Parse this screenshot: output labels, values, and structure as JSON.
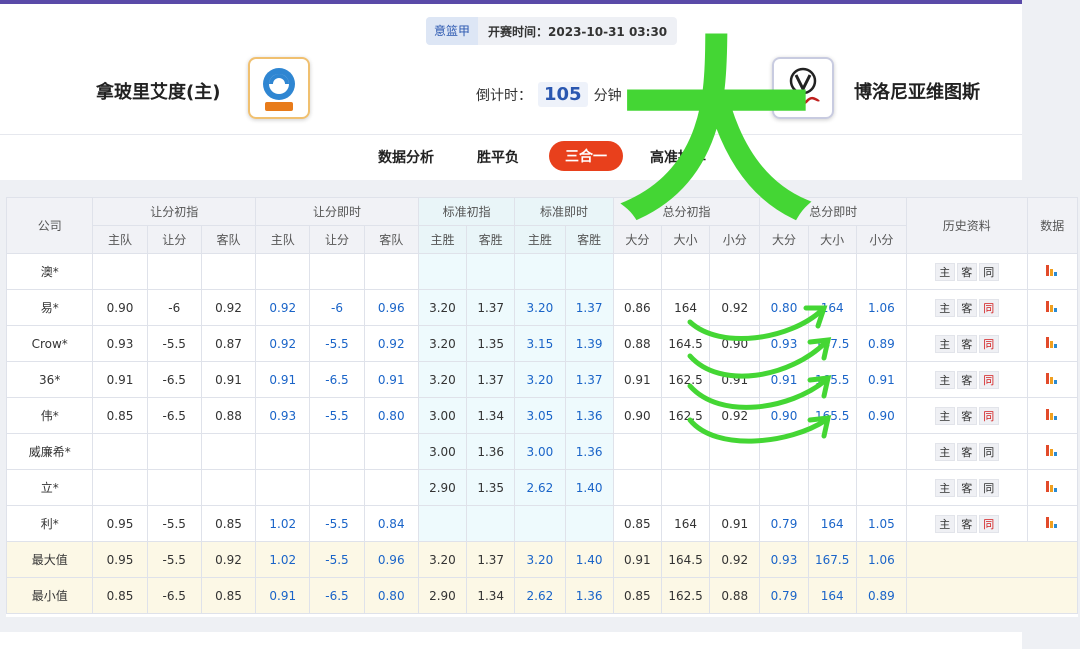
{
  "header": {
    "league": "意篮甲",
    "kickoff": "开赛时间：2023-10-31 03:30",
    "home_team": "拿玻里艾度(主)",
    "away_team": "博洛尼亚维图斯",
    "countdown_label": "倒计时：",
    "countdown_value": "105",
    "countdown_unit": "分钟"
  },
  "tabs": [
    {
      "label": "数据分析"
    },
    {
      "label": "胜平负"
    },
    {
      "label": "三合一"
    },
    {
      "label": "高准推荐"
    }
  ],
  "annotation": "大",
  "table": {
    "company_col": "公司",
    "groups": [
      "让分初指",
      "让分即时",
      "标准初指",
      "标准即时",
      "总分初指",
      "总分即时"
    ],
    "history_col": "历史资料",
    "data_col": "数据",
    "sub": {
      "handicap": [
        "主队",
        "让分",
        "客队"
      ],
      "standard": [
        "主胜",
        "客胜"
      ],
      "total": [
        "大分",
        "大小",
        "小分"
      ]
    },
    "hist_btns": [
      "主",
      "客",
      "同"
    ],
    "rows": [
      {
        "company": "澳*",
        "hi": [
          "",
          "",
          ""
        ],
        "hn": [
          "",
          "",
          ""
        ],
        "si": [
          "",
          ""
        ],
        "sn": [
          "",
          ""
        ],
        "ti": [
          "",
          "",
          ""
        ],
        "tn": [
          "",
          "",
          ""
        ],
        "same_red": false
      },
      {
        "company": "易*",
        "hi": [
          "0.90",
          "-6",
          "0.92"
        ],
        "hn": [
          "0.92",
          "-6",
          "0.96"
        ],
        "si": [
          "3.20",
          "1.37"
        ],
        "sn": [
          "3.20",
          "1.37"
        ],
        "ti": [
          "0.86",
          "164",
          "0.92"
        ],
        "tn": [
          "0.80",
          "164",
          "1.06"
        ],
        "same_red": true
      },
      {
        "company": "Crow*",
        "hi": [
          "0.93",
          "-5.5",
          "0.87"
        ],
        "hn": [
          "0.92",
          "-5.5",
          "0.92"
        ],
        "si": [
          "3.20",
          "1.35"
        ],
        "sn": [
          "3.15",
          "1.39"
        ],
        "ti": [
          "0.88",
          "164.5",
          "0.90"
        ],
        "tn": [
          "0.93",
          "167.5",
          "0.89"
        ],
        "same_red": true
      },
      {
        "company": "36*",
        "hi": [
          "0.91",
          "-6.5",
          "0.91"
        ],
        "hn": [
          "0.91",
          "-6.5",
          "0.91"
        ],
        "si": [
          "3.20",
          "1.37"
        ],
        "sn": [
          "3.20",
          "1.37"
        ],
        "ti": [
          "0.91",
          "162.5",
          "0.91"
        ],
        "tn": [
          "0.91",
          "165.5",
          "0.91"
        ],
        "same_red": true
      },
      {
        "company": "伟*",
        "hi": [
          "0.85",
          "-6.5",
          "0.88"
        ],
        "hn": [
          "0.93",
          "-5.5",
          "0.80"
        ],
        "si": [
          "3.00",
          "1.34"
        ],
        "sn": [
          "3.05",
          "1.36"
        ],
        "ti": [
          "0.90",
          "162.5",
          "0.92"
        ],
        "tn": [
          "0.90",
          "165.5",
          "0.90"
        ],
        "same_red": true
      },
      {
        "company": "威廉希*",
        "hi": [
          "",
          "",
          ""
        ],
        "hn": [
          "",
          "",
          ""
        ],
        "si": [
          "3.00",
          "1.36"
        ],
        "sn": [
          "3.00",
          "1.36"
        ],
        "ti": [
          "",
          "",
          ""
        ],
        "tn": [
          "",
          "",
          ""
        ],
        "same_red": false
      },
      {
        "company": "立*",
        "hi": [
          "",
          "",
          ""
        ],
        "hn": [
          "",
          "",
          ""
        ],
        "si": [
          "2.90",
          "1.35"
        ],
        "sn": [
          "2.62",
          "1.40"
        ],
        "ti": [
          "",
          "",
          ""
        ],
        "tn": [
          "",
          "",
          ""
        ],
        "same_red": false
      },
      {
        "company": "利*",
        "hi": [
          "0.95",
          "-5.5",
          "0.85"
        ],
        "hn": [
          "1.02",
          "-5.5",
          "0.84"
        ],
        "si": [
          "",
          ""
        ],
        "sn": [
          "",
          ""
        ],
        "ti": [
          "0.85",
          "164",
          "0.91"
        ],
        "tn": [
          "0.79",
          "164",
          "1.05"
        ],
        "same_red": true
      }
    ],
    "summary": [
      {
        "label": "最大值",
        "hi": [
          "0.95",
          "-5.5",
          "0.92"
        ],
        "hn": [
          "1.02",
          "-5.5",
          "0.96"
        ],
        "si": [
          "3.20",
          "1.37"
        ],
        "sn": [
          "3.20",
          "1.40"
        ],
        "ti": [
          "0.91",
          "164.5",
          "0.92"
        ],
        "tn": [
          "0.93",
          "167.5",
          "1.06"
        ]
      },
      {
        "label": "最小值",
        "hi": [
          "0.85",
          "-6.5",
          "0.85"
        ],
        "hn": [
          "0.91",
          "-6.5",
          "0.80"
        ],
        "si": [
          "2.90",
          "1.34"
        ],
        "sn": [
          "2.62",
          "1.36"
        ],
        "ti": [
          "0.85",
          "162.5",
          "0.88"
        ],
        "tn": [
          "0.79",
          "164",
          "0.89"
        ]
      }
    ]
  },
  "colors": {
    "accent": "#e8401c",
    "link_blue": "#1a64c8",
    "annotation_green": "#44d634"
  }
}
